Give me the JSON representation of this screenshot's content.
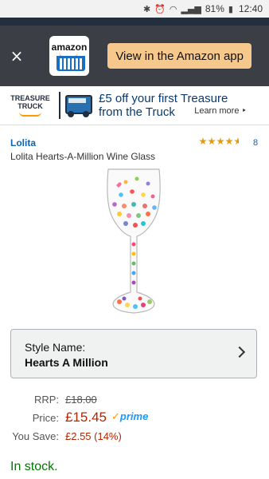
{
  "status_bar": {
    "icons": [
      "bluetooth-icon",
      "alarm-icon",
      "wifi-icon",
      "signal-icon",
      "battery-icon"
    ],
    "battery": "81%",
    "time": "12:40"
  },
  "app_banner": {
    "close": "×",
    "logo_word": "amazon",
    "button_label": "View in the Amazon app",
    "button_color": "#f6c88b"
  },
  "promo": {
    "badge_line1": "TREASURE",
    "badge_line2": "TRUCK",
    "line1": "£5 off your first Treasure",
    "line2": "from the Truck",
    "learn_more": "Learn more ‣"
  },
  "product": {
    "brand": "Lolita",
    "rating_stars": 4.5,
    "rating_count": "8",
    "title": "Lolita Hearts-A-Million Wine Glass"
  },
  "style": {
    "label": "Style Name:",
    "value": "Hearts A Million"
  },
  "pricing": {
    "rrp_label": "RRP:",
    "rrp_value": "£18.00",
    "price_label": "Price:",
    "price_value": "£15.45",
    "prime_label": "prime",
    "save_label": "You Save:",
    "save_value": "£2.55 (14%)"
  },
  "availability": "In stock.",
  "colors": {
    "accent_orange": "#f90",
    "price_red": "#b12704",
    "link_blue": "#0a66b2",
    "stock_green": "#007600"
  }
}
